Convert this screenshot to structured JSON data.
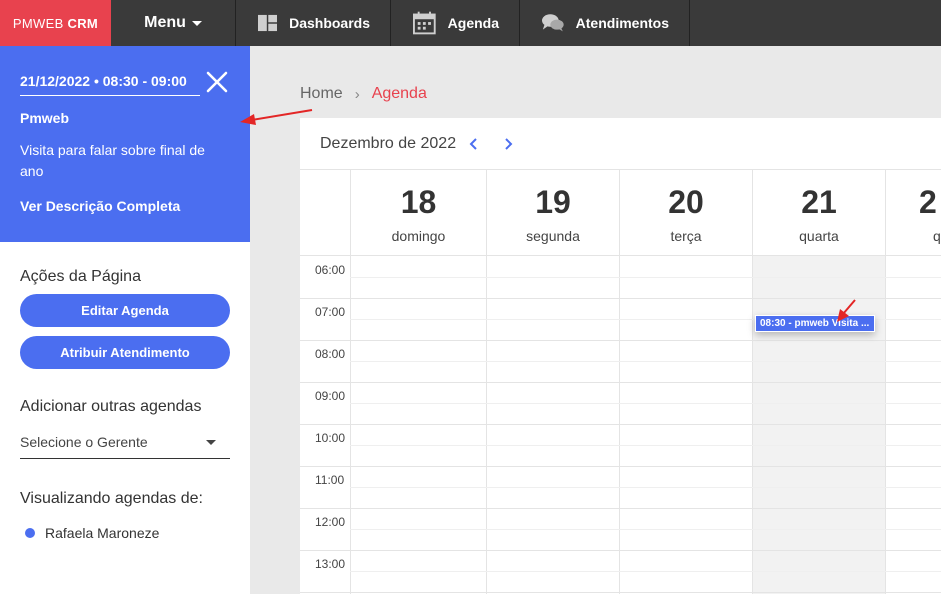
{
  "brand": {
    "prefix": "PMWEB",
    "name": "CRM"
  },
  "topnav": {
    "menu_label": "Menu",
    "items": [
      {
        "label": "Dashboards",
        "icon": "dashboard-icon"
      },
      {
        "label": "Agenda",
        "icon": "calendar-icon"
      },
      {
        "label": "Atendimentos",
        "icon": "chat-icon"
      }
    ]
  },
  "event_detail": {
    "datetime": "21/12/2022 • 08:30 - 09:00",
    "owner": "Pmweb",
    "description": "Visita para falar sobre final de ano",
    "link": "Ver Descrição Completa"
  },
  "sidebar": {
    "actions_title": "Ações da Página",
    "edit_button": "Editar Agenda",
    "assign_button": "Atribuir Atendimento",
    "add_title": "Adicionar outras agendas",
    "manager_select": "Selecione o Gerente",
    "viewing_title": "Visualizando agendas de:",
    "viewing_person": "Rafaela Maroneze"
  },
  "breadcrumb": {
    "home": "Home",
    "sep": "›",
    "current": "Agenda"
  },
  "calendar": {
    "month_label": "Dezembro de 2022",
    "days": [
      {
        "num": "18",
        "name": "domingo"
      },
      {
        "num": "19",
        "name": "segunda"
      },
      {
        "num": "20",
        "name": "terça"
      },
      {
        "num": "21",
        "name": "quarta"
      },
      {
        "num": "2",
        "name": "q"
      }
    ],
    "hours": [
      "06:00",
      "07:00",
      "08:00",
      "09:00",
      "10:00",
      "11:00",
      "12:00",
      "13:00"
    ],
    "event_chip": "08:30 - pmweb Visita ..."
  },
  "colors": {
    "brand_red": "#e8424e",
    "accent_blue": "#4b6ef0",
    "topbar": "#3a3a3a"
  }
}
